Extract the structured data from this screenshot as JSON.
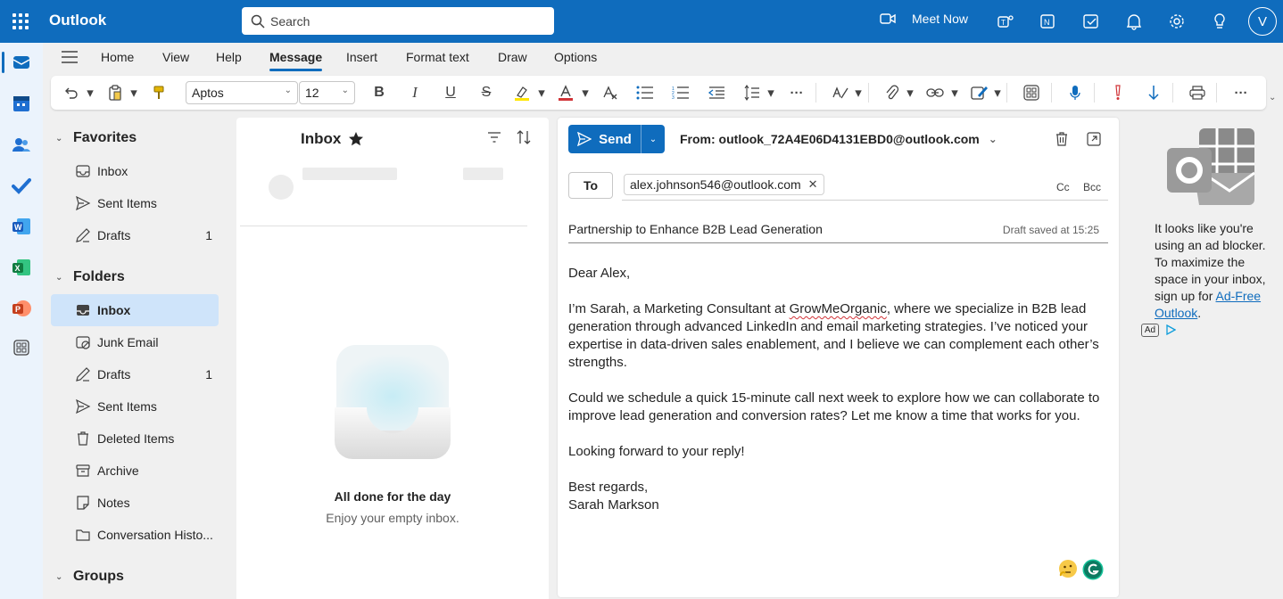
{
  "app": {
    "title": "Outlook",
    "account_initial": "V"
  },
  "search": {
    "placeholder": "Search"
  },
  "topbar": {
    "meet_now_label": "Meet Now"
  },
  "ribbon": {
    "tabs": [
      "Home",
      "View",
      "Help",
      "Message",
      "Insert",
      "Format text",
      "Draw",
      "Options"
    ],
    "active_tab": "Message",
    "font_name": "Aptos",
    "font_size": "12"
  },
  "folders": {
    "favorites_label": "Favorites",
    "favorites": [
      {
        "label": "Inbox",
        "count": ""
      },
      {
        "label": "Sent Items",
        "count": ""
      },
      {
        "label": "Drafts",
        "count": "1"
      }
    ],
    "folders_label": "Folders",
    "items": [
      {
        "label": "Inbox",
        "count": ""
      },
      {
        "label": "Junk Email",
        "count": ""
      },
      {
        "label": "Drafts",
        "count": "1"
      },
      {
        "label": "Sent Items",
        "count": ""
      },
      {
        "label": "Deleted Items",
        "count": ""
      },
      {
        "label": "Archive",
        "count": ""
      },
      {
        "label": "Notes",
        "count": ""
      },
      {
        "label": "Conversation Histo...",
        "count": ""
      }
    ],
    "groups_label": "Groups"
  },
  "message_list": {
    "title": "Inbox",
    "empty_title": "All done for the day",
    "empty_subtitle": "Enjoy your empty inbox."
  },
  "compose": {
    "send_label": "Send",
    "from": "From: outlook_72A4E06D4131EBD0@outlook.com",
    "to_label": "To",
    "recipient": "alex.johnson546@outlook.com",
    "cc_label": "Cc",
    "bcc_label": "Bcc",
    "subject": "Partnership to Enhance B2B Lead Generation",
    "draft_status": "Draft saved at 15:25",
    "body": {
      "greeting": "Dear Alex,",
      "p1_before": "I’m Sarah, a Marketing Consultant at ",
      "p1_company": "GrowMeOrganic",
      "p1_after": ", where we specialize in B2B lead generation through advanced LinkedIn and email marketing strategies. I’ve noticed your expertise in data-driven sales enablement, and I believe we can complement each other’s strengths.",
      "p2": "Could we schedule a quick 15-minute call next week to explore how we can collaborate to improve lead generation and conversion rates? Let me know a time that works for you.",
      "p3": "Looking forward to your reply!",
      "signoff": "Best regards,",
      "signature": "Sarah Markson"
    }
  },
  "ad": {
    "text": "It looks like you're using an ad blocker. To maximize the space in your inbox, sign up for ",
    "link": "Ad-Free Outlook",
    "after": ".",
    "badge": "Ad"
  },
  "colors": {
    "brand": "#0f6cbd",
    "selected": "#cfe4fa"
  }
}
